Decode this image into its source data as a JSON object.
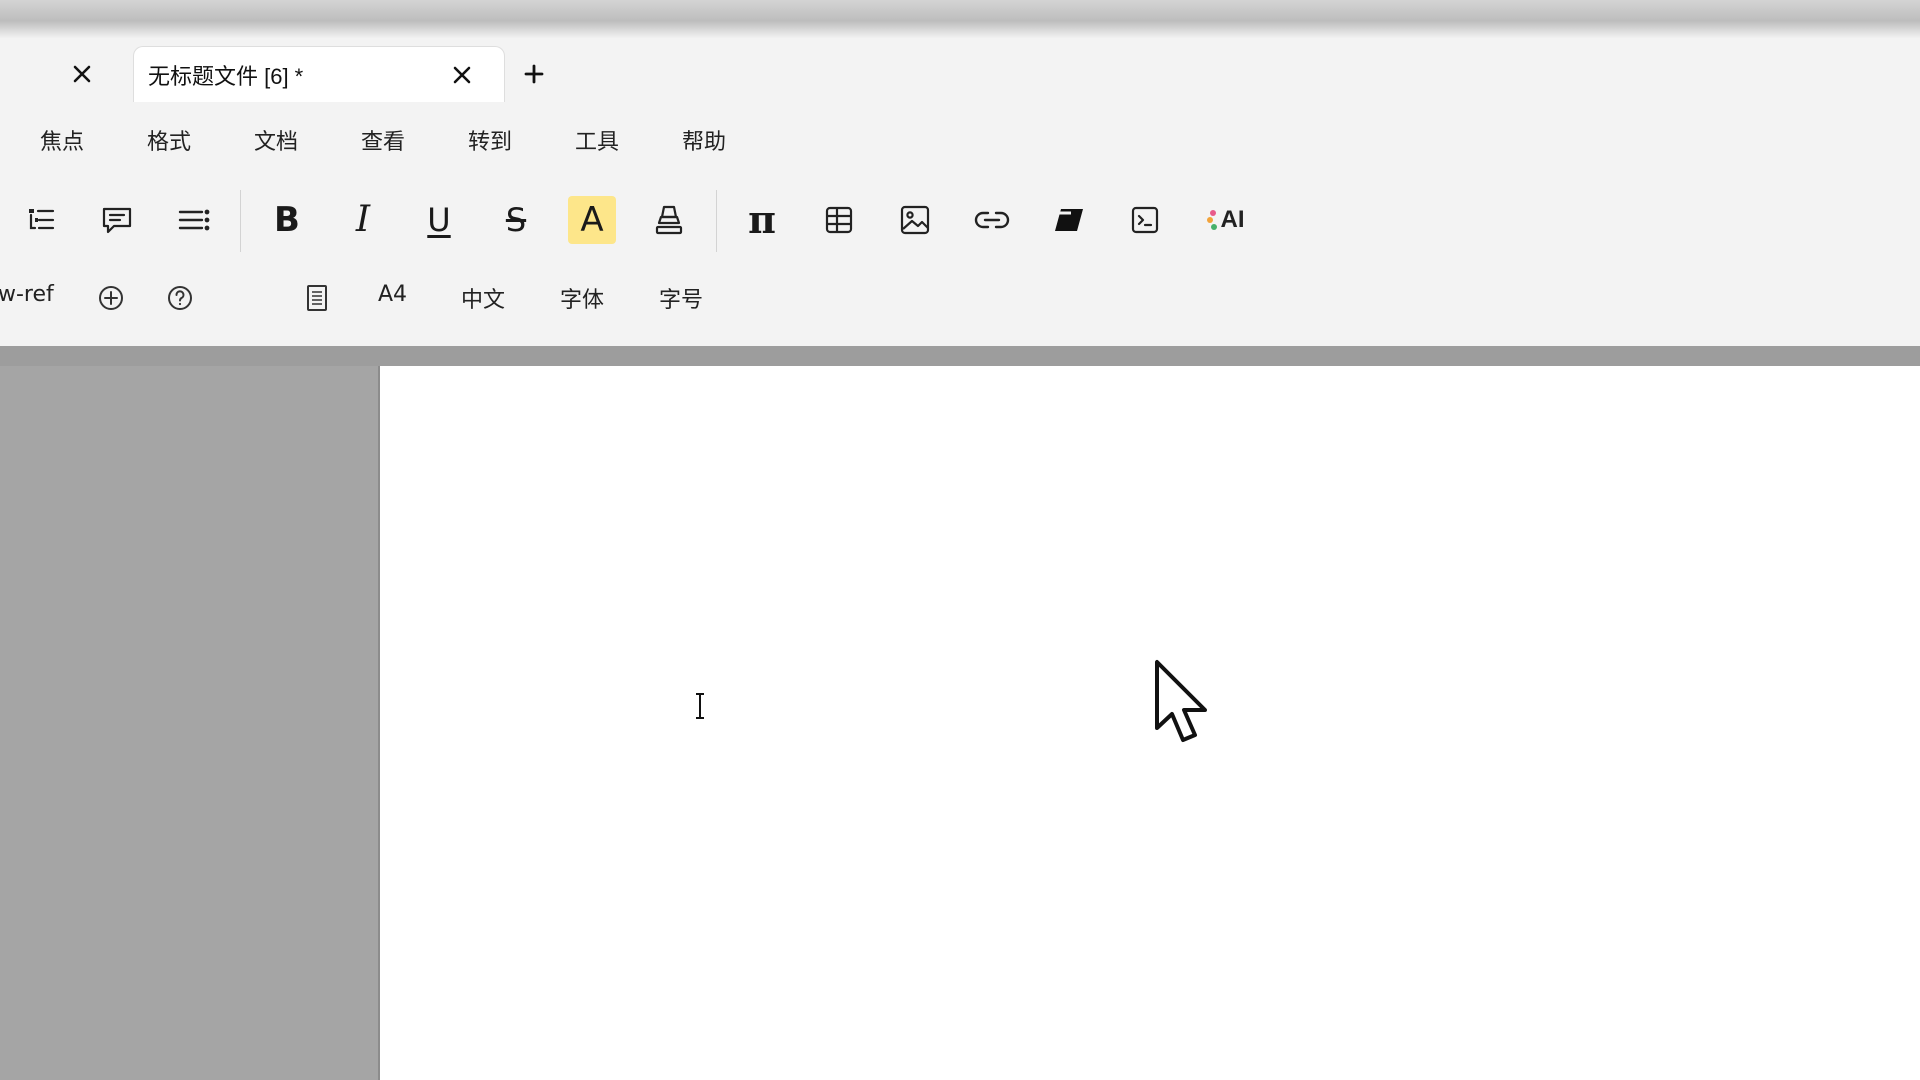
{
  "tabs": {
    "active_title": "无标题文件 [6] *"
  },
  "menu": {
    "items": [
      "焦点",
      "格式",
      "文档",
      "查看",
      "转到",
      "工具",
      "帮助"
    ]
  },
  "toolbar": {
    "highlight_color": "#fde68a",
    "ai_label": "AI",
    "bold_glyph": "B",
    "italic_glyph": "I",
    "underline_glyph": "U",
    "strike_glyph": "S",
    "fontcolor_glyph": "A",
    "math_glyph": "π"
  },
  "status": {
    "ref_label": "w-ref",
    "page_size": "A4",
    "language": "中文",
    "font_label": "字体",
    "font_size_label": "字号"
  },
  "colors": {
    "chrome_bg": "#f3f3f3",
    "canvas_bg": "#a5a5a5",
    "page_bg": "#ffffff"
  }
}
